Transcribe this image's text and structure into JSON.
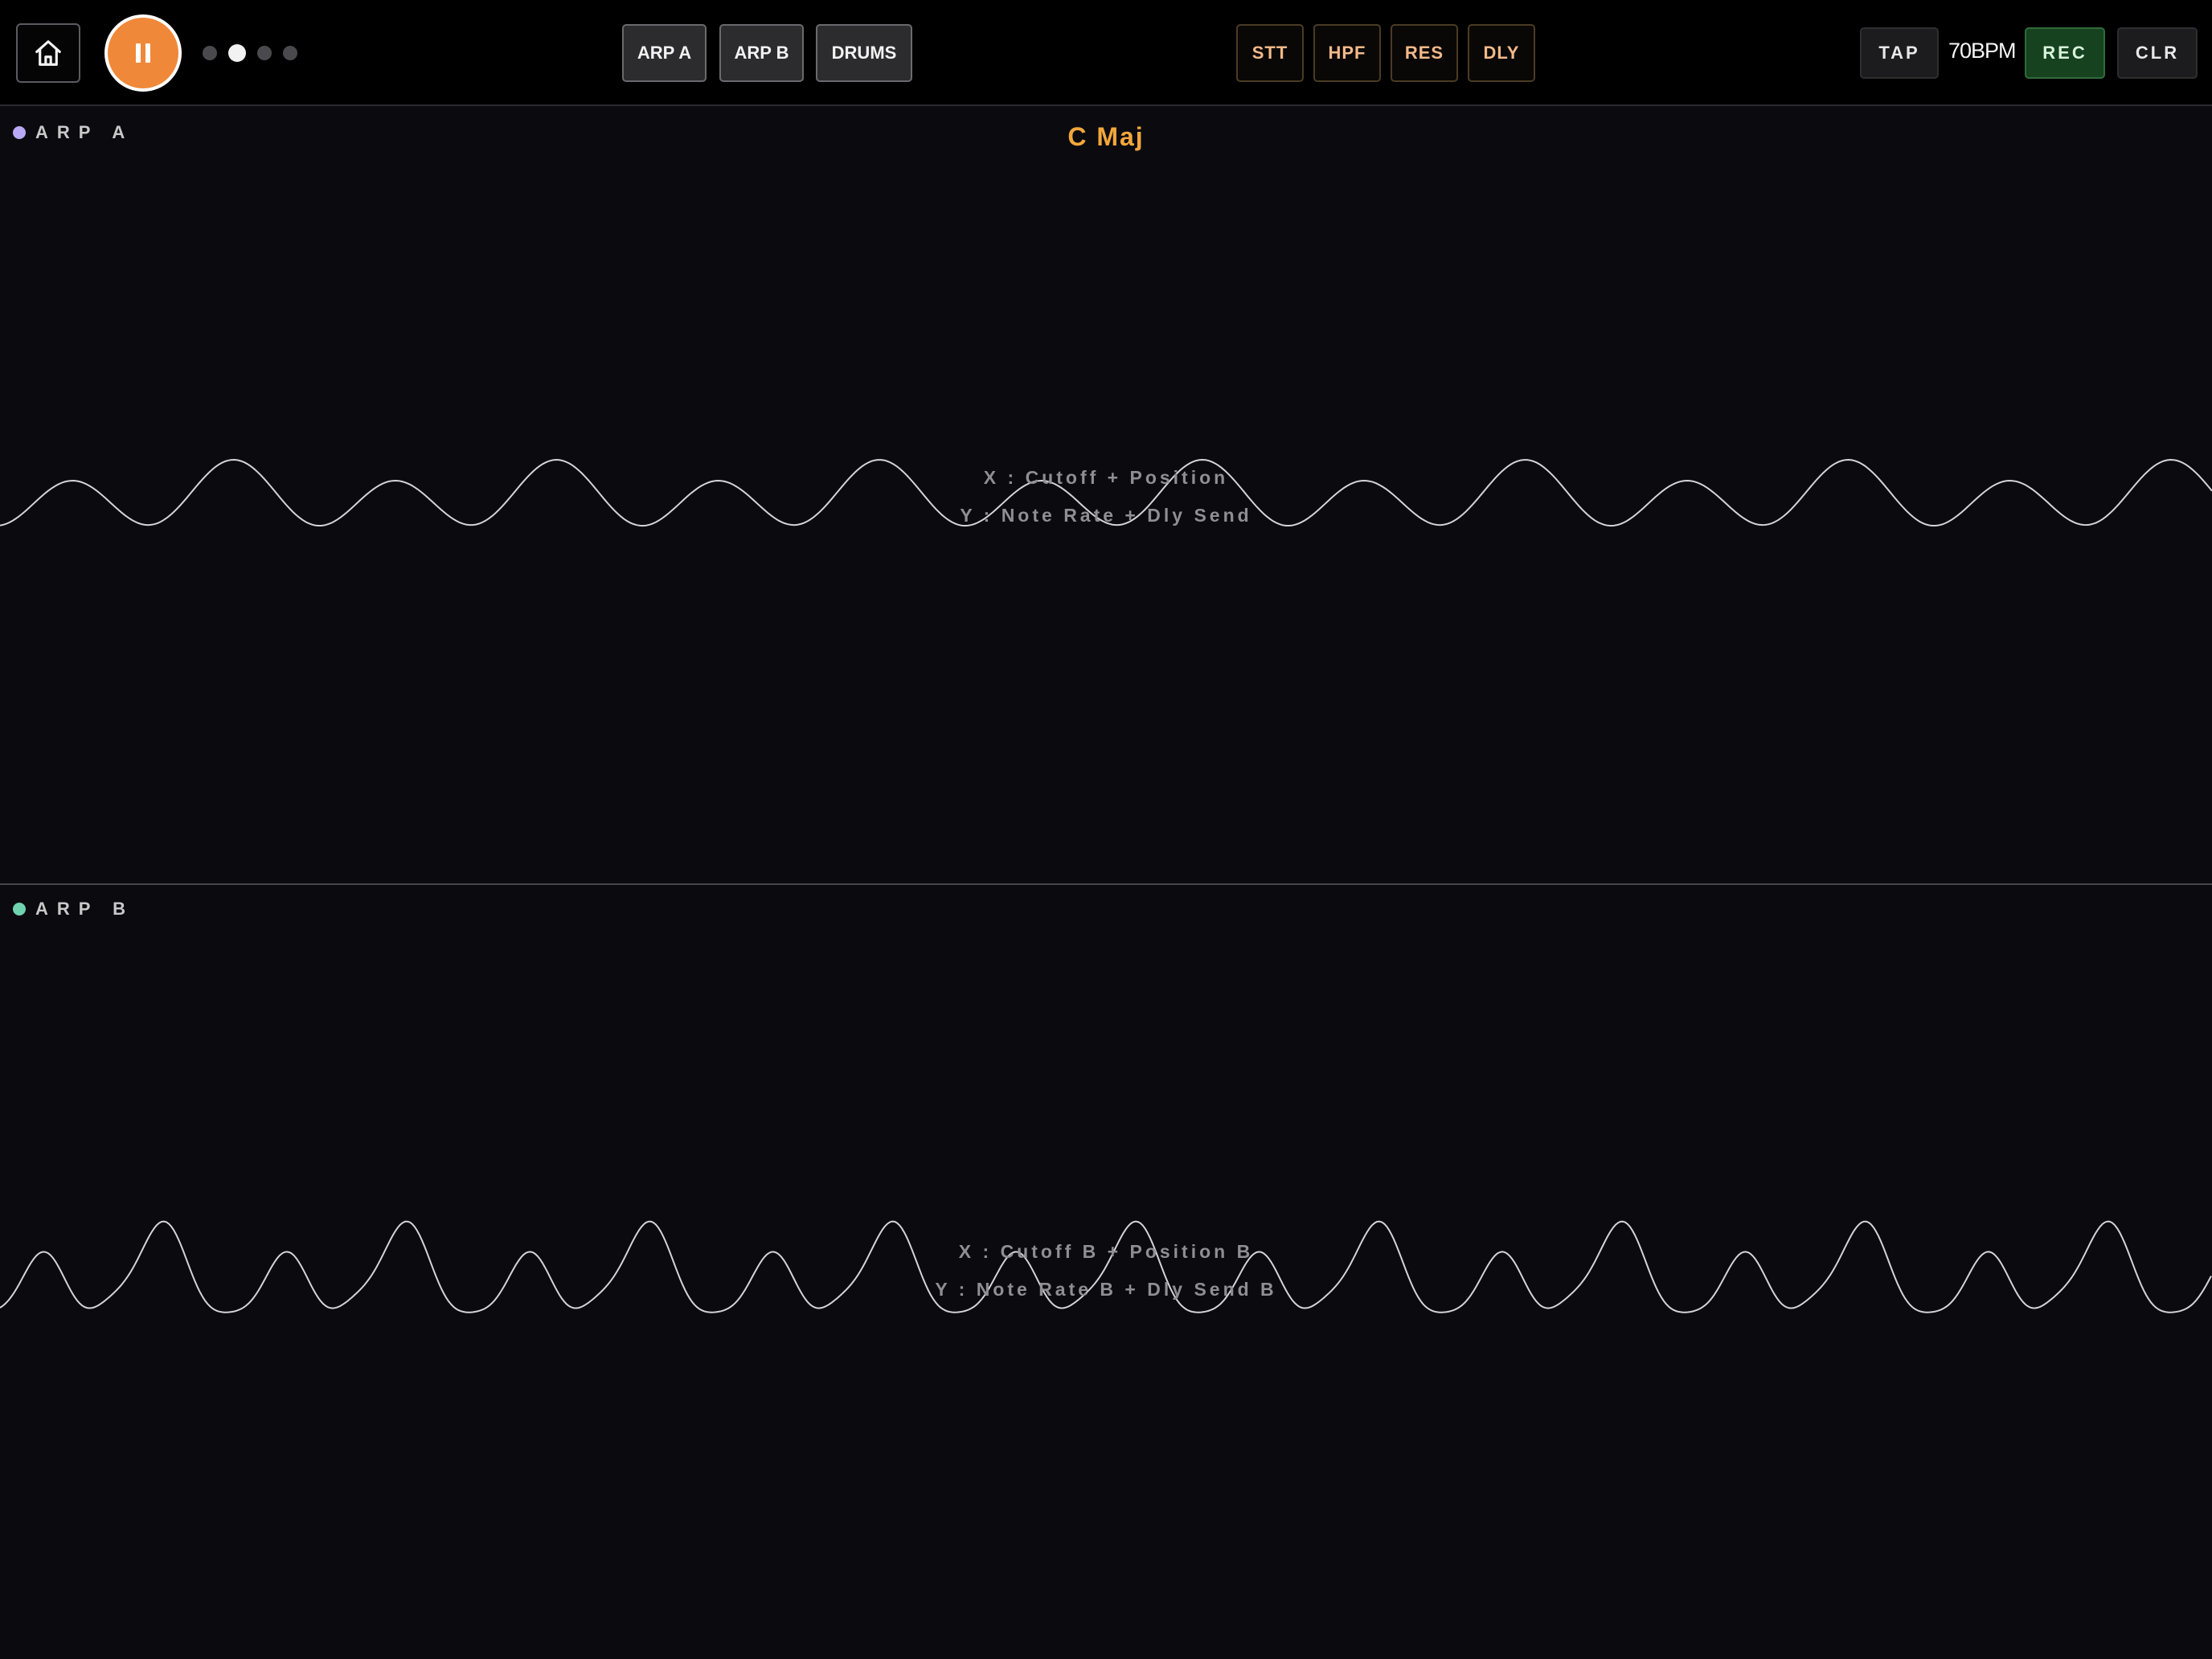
{
  "toolbar": {
    "home_icon": "home-icon",
    "play_state_icon": "pause-icon",
    "page_dots": [
      false,
      true,
      false,
      false
    ],
    "tracks": [
      "ARP A",
      "ARP B",
      "DRUMS"
    ],
    "effects": [
      "STT",
      "HPF",
      "RES",
      "DLY"
    ],
    "tap_label": "TAP",
    "bpm": "70BPM",
    "rec_label": "REC",
    "clr_label": "CLR"
  },
  "colors": {
    "accent_orange": "#f0883a",
    "chord_color": "#f3a73b",
    "arp_a_dot": "#b9a8f5",
    "arp_b_dot": "#6fd3b0",
    "rec_green": "#16421f"
  },
  "panel_a": {
    "label": "ARP A",
    "chord": "C Maj",
    "x_axis": "X : Cutoff + Position",
    "y_axis": "Y : Note Rate + Dly Send"
  },
  "panel_b": {
    "label": "ARP B",
    "x_axis": "X : Cutoff B + Position B",
    "y_axis": "Y : Note Rate B + Dly Send B"
  }
}
